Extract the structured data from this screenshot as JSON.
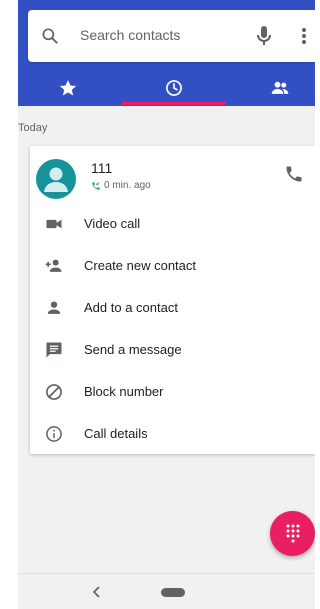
{
  "search": {
    "placeholder": "Search contacts"
  },
  "tabs": [
    {
      "name": "favorites",
      "icon": "star-icon"
    },
    {
      "name": "recents",
      "icon": "clock-icon",
      "selected": true
    },
    {
      "name": "contacts",
      "icon": "people-icon"
    }
  ],
  "section": {
    "label": "Today"
  },
  "call_entry": {
    "name": "111",
    "time": "0 min. ago",
    "call_type_icon": "incoming-call-icon"
  },
  "actions": [
    {
      "label": "Video call",
      "icon": "video-camera-icon"
    },
    {
      "label": "Create new contact",
      "icon": "add-person-icon"
    },
    {
      "label": "Add to a contact",
      "icon": "person-icon"
    },
    {
      "label": "Send a message",
      "icon": "message-icon"
    },
    {
      "label": "Block number",
      "icon": "block-icon"
    },
    {
      "label": "Call details",
      "icon": "info-icon"
    }
  ],
  "colors": {
    "header": "#3250c4",
    "accent": "#e91e63",
    "avatar": "#16939b",
    "incoming_call": "#34a853",
    "icon": "#5f6368"
  }
}
